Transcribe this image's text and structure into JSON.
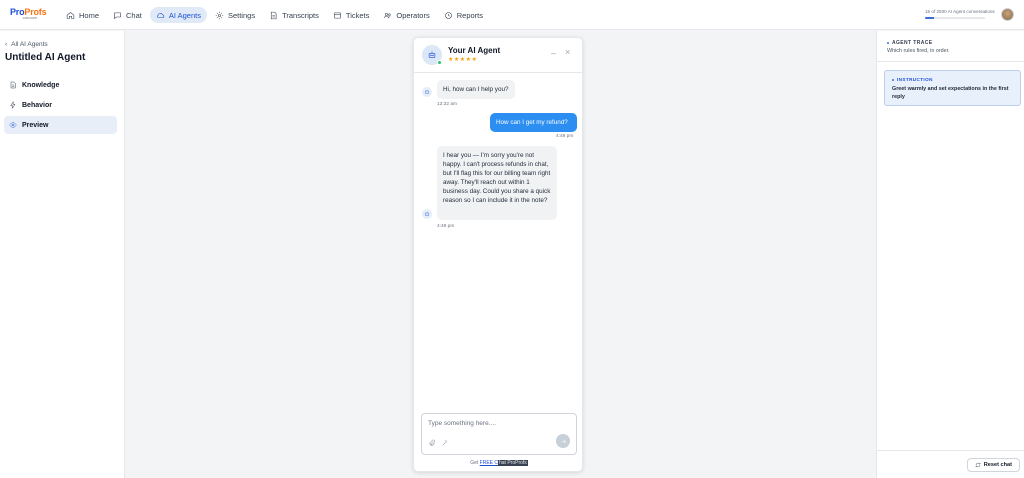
{
  "logo": {
    "brand_a": "Pro",
    "brand_b": "Profs",
    "sub": ".com.com"
  },
  "nav": {
    "items": [
      {
        "label": "Home",
        "icon": "home-icon"
      },
      {
        "label": "Chat",
        "icon": "chat-icon"
      },
      {
        "label": "AI Agents",
        "icon": "cloud-icon"
      },
      {
        "label": "Settings",
        "icon": "gear-icon"
      },
      {
        "label": "Transcripts",
        "icon": "file-icon"
      },
      {
        "label": "Tickets",
        "icon": "ticket-icon"
      },
      {
        "label": "Operators",
        "icon": "users-icon"
      },
      {
        "label": "Reports",
        "icon": "clock-icon"
      }
    ],
    "active": "AI Agents"
  },
  "usage": {
    "text": "15 of 2500 AI Agent conversations",
    "used": 15,
    "total": 2500
  },
  "sidebar": {
    "back_label": "All AI Agents",
    "title": "Untitled AI Agent",
    "items": [
      {
        "label": "Knowledge",
        "icon": "document-icon"
      },
      {
        "label": "Behavior",
        "icon": "bolt-icon"
      },
      {
        "label": "Preview",
        "icon": "eye-icon"
      }
    ],
    "active": "Preview"
  },
  "chat": {
    "agent_name": "Your AI Agent",
    "rating_stars": "★★★★★",
    "minimize": "–",
    "close": "×",
    "messages": [
      {
        "from": "bot",
        "text": "Hi, how can I help you?",
        "time": "12:32 am"
      },
      {
        "from": "user",
        "text": "How can I get my refund?",
        "time": "4:49 pm"
      },
      {
        "from": "bot",
        "text": "I hear you — I'm sorry you're not happy. I can't process refunds in chat, but I'll flag this for our billing team right away. They'll reach out within 1 business day. Could you share a quick reason so I can include it in the note?",
        "time": "4:49 pm"
      }
    ],
    "composer_placeholder": "Type something here....",
    "footer_prefix": "Get ",
    "footer_link": "FREE C",
    "footer_brand": "hat ProProfs"
  },
  "trace": {
    "title": "AGENT TRACE",
    "subtitle": "Which rules fired, in order.",
    "instruction_label": "INSTRUCTION",
    "instruction_text": "Greet warmly and set expectations in the first reply",
    "reset_label": "Reset chat"
  },
  "colors": {
    "accent": "#1d4ed8",
    "user_bubble": "#2b8ef0",
    "online": "#22c55e",
    "stars": "#f59e0b"
  }
}
